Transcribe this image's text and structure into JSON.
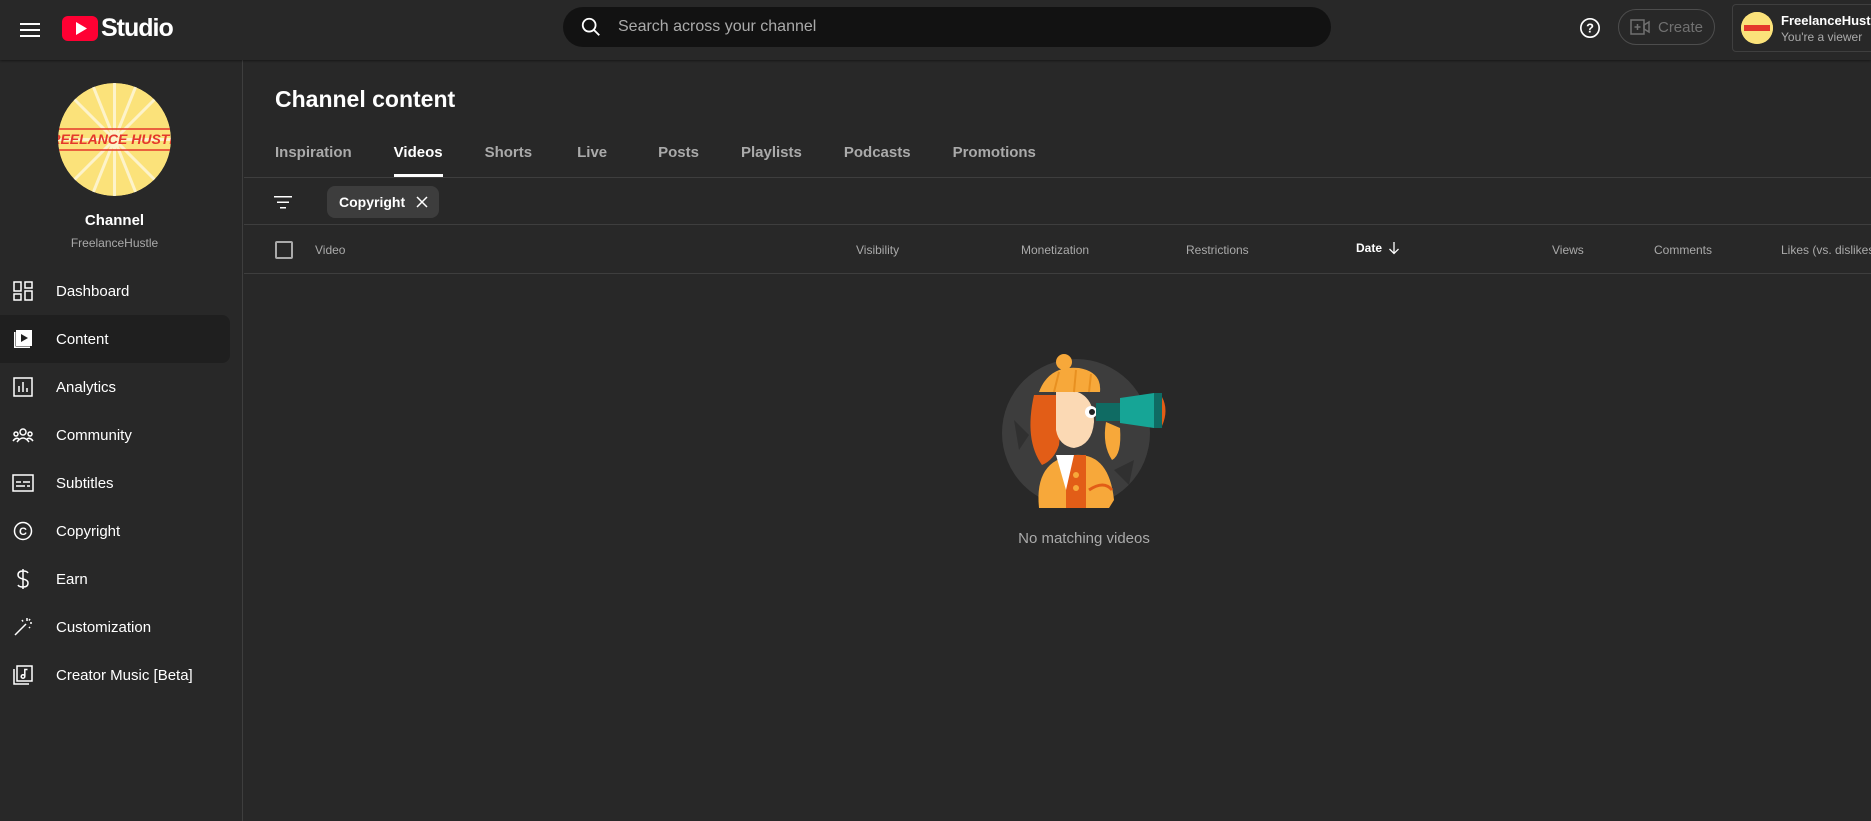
{
  "header": {
    "logo_text": "Studio",
    "search_placeholder": "Search across your channel",
    "create_label": "Create",
    "account_name": "FreelanceHustle",
    "account_role": "You're a viewer"
  },
  "sidebar": {
    "channel_title": "Channel",
    "channel_handle": "FreelanceHustle",
    "channel_avatar_text": "FREELANCE HUSTLE",
    "items": [
      {
        "label": "Dashboard",
        "icon": "dashboard-icon"
      },
      {
        "label": "Content",
        "icon": "content-icon",
        "active": true
      },
      {
        "label": "Analytics",
        "icon": "analytics-icon"
      },
      {
        "label": "Community",
        "icon": "community-icon"
      },
      {
        "label": "Subtitles",
        "icon": "subtitles-icon"
      },
      {
        "label": "Copyright",
        "icon": "copyright-icon"
      },
      {
        "label": "Earn",
        "icon": "dollar-icon"
      },
      {
        "label": "Customization",
        "icon": "magic-wand-icon"
      },
      {
        "label": "Creator Music [Beta]",
        "icon": "music-icon"
      }
    ]
  },
  "main": {
    "title": "Channel content",
    "tabs": [
      "Inspiration",
      "Videos",
      "Shorts",
      "Live",
      "Posts",
      "Playlists",
      "Podcasts",
      "Promotions"
    ],
    "active_tab": "Videos",
    "filter_chip": "Copyright",
    "columns": {
      "video": "Video",
      "visibility": "Visibility",
      "monetization": "Monetization",
      "restrictions": "Restrictions",
      "date": "Date",
      "views": "Views",
      "comments": "Comments",
      "likes": "Likes (vs. dislikes)"
    },
    "empty_message": "No matching videos"
  },
  "colors": {
    "accent_red": "#ff0033",
    "background": "#282828",
    "avatar_yellow": "#fbe27a"
  }
}
